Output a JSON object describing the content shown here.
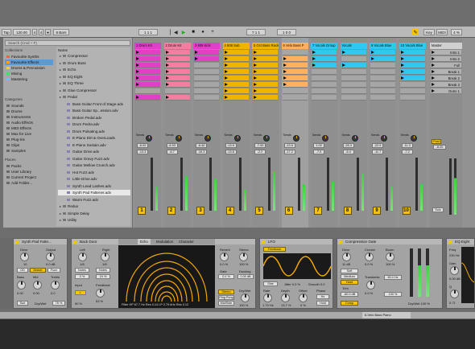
{
  "transport": {
    "tap": "Tap",
    "tempo": "120.00",
    "meter_num": "4",
    "meter_den": "4",
    "quant": "8 Bars",
    "position": "1 1 1",
    "loop_start": "7 1 1",
    "loop_len": "1 0 0",
    "key_label": "Key",
    "midi_label": "MIDI",
    "cpu": "4 %"
  },
  "browser": {
    "search_placeholder": "Search (Cmd + F)",
    "collections_header": "Collections",
    "collections": [
      "Favourite Synths",
      "Favourite Effects",
      "Drums & Percussion",
      "Mixing",
      "Mastering"
    ],
    "collection_colors": [
      "#ff5e3a",
      "#ff9f1a",
      "#ffd11a",
      "#4cd964",
      "#5ac8fa"
    ],
    "categories_header": "Categories",
    "categories": [
      "Sounds",
      "Drums",
      "Instruments",
      "Audio Effects",
      "MIDI Effects",
      "Max for Live",
      "Plug-Ins",
      "Clips",
      "Samples"
    ],
    "places_header": "Places",
    "places": [
      "Packs",
      "User Library",
      "Current Project",
      "Add Folder..."
    ],
    "name_header": "Name",
    "files": [
      "Compressor",
      "Drum Buss",
      "Echo",
      "EQ Eight",
      "EQ Three",
      "Glue Compressor",
      "Pedal",
      "Bass Guitar Front of Stage.adv",
      "Bass Guitar Sp...ession.adv",
      "Broken Pedal.adv",
      "Drum Pedra.adv",
      "Drum Pulsating.adv",
      "E-Piano Dirt & OverLoads",
      "E-Piano Sustain.adv",
      "Guitar Drive.adv",
      "Guitar Gravy Fuzz.adv",
      "Guitar Mellow Crunch.adv",
      "Hot Fuzz.adv",
      "Little Drive.adv",
      "Synth Lead Lashes.adv",
      "Synth Pad Fattener.adv",
      "Warm Fuzz.adv",
      "Redux",
      "Simple Delay",
      "Utility"
    ]
  },
  "tracks": [
    {
      "name": "1 Drum Kit",
      "color": "#e040c8",
      "num": "1"
    },
    {
      "name": "2 Drum Kit",
      "color": "#f27fa0",
      "num": "2"
    },
    {
      "name": "3 808 Kick",
      "color": "#e040c8",
      "num": "3"
    },
    {
      "name": "4 808 Sub",
      "color": "#f0b400",
      "num": "4"
    },
    {
      "name": "5 Oct Bass Rack",
      "color": "#f0b400",
      "num": "5"
    },
    {
      "name": "6 Velo Bass P",
      "color": "#ffb060",
      "num": "6"
    },
    {
      "name": "7 Vocals Group",
      "color": "#30c8f0",
      "num": "7"
    },
    {
      "name": "Vocals",
      "color": "#30c8f0",
      "num": "8"
    },
    {
      "name": "9 Vocals Blue",
      "color": "#30c8f0",
      "num": "9"
    },
    {
      "name": "10 Vocals Blue",
      "color": "#30c8f0",
      "num": "10"
    }
  ],
  "track_volumes": [
    "-6.00",
    "-8.93",
    "-6.40",
    "-13.9",
    "-7.00",
    "-13.5",
    "1.00",
    "-28.3",
    "-22.9",
    "-11.3"
  ],
  "track_peaks": [
    "-13.3",
    "-6.7",
    "-16.3",
    "-13.8",
    "-2.2",
    "-17.2",
    "-7.0",
    "-6.4",
    "-11.7",
    "-7.2"
  ],
  "sends_label": "Sends",
  "master": {
    "name": "Master",
    "scenes": [
      "Intro 1",
      "Intro 2",
      "Full",
      "Break 1",
      "Break 2",
      "Break 3",
      "Outro 1"
    ],
    "volume": "-8.20",
    "post": "Post",
    "solo": "Solo"
  },
  "devices": {
    "synth_pad": {
      "title": "Synth Pad Fatte...",
      "labels": [
        "Drive",
        "Output",
        "Bass",
        "Mid",
        "Treble",
        "Dry/Wet"
      ],
      "values": [
        "10",
        "0.0 dB",
        "0.00",
        "0.00",
        "0.0",
        "75 %"
      ],
      "buttons": [
        "OD",
        "Distort",
        "Fuzz",
        "Sub"
      ]
    },
    "back_door": {
      "title": "Back Door",
      "left": "Left",
      "right": "Right",
      "sync1": "1/8",
      "sync2": "1/8",
      "mode1": "Notes",
      "mode2": "Notes",
      "pct1": "0 %",
      "pct2": "24 %",
      "feedback": "Feedback",
      "fb_val": "63 %",
      "input": "Input",
      "dry_wet": "90 %"
    },
    "echo_tabs": [
      "Echo",
      "Modulation",
      "Character"
    ],
    "echo_footer": {
      "filter": "Filter HP",
      "hp": "67.7 Hz",
      "res1": "Res",
      "res1_val": "0.14",
      "lp": "LP",
      "lp_val": "2.79 kHz",
      "res2": "Res",
      "res2_val": "0.12"
    },
    "reverb": {
      "labels": [
        "Reverb",
        "Stereo",
        "Gate",
        "Ducking",
        "Dry/Wet"
      ],
      "values": [
        "0.0 %",
        "100 %",
        "0.0 %",
        "0.00 dB",
        "100 %"
      ],
      "buttons": [
        "Stereo",
        "Ping Pong",
        "Mid/Side"
      ]
    },
    "lfo": {
      "title": "LFO",
      "feedback": "Feedback",
      "shape": "Sine",
      "jitter": "Jitter",
      "jitter_val": "0.0 %",
      "smooth": "Smooth",
      "smooth_val": "0.0",
      "labels": [
        "Rate",
        "Depth",
        "Offset",
        "Phase"
      ],
      "values": [
        "1.79 Hz",
        "13.7 %",
        "0 %",
        "0.0"
      ],
      "hold": "Hold",
      "hz": "Hz"
    },
    "comp_gate": {
      "title": "Compression Gate",
      "labels": [
        "Drive",
        "Crunch",
        "Boom",
        "Thresh"
      ],
      "values": [
        "11 dB",
        "0.0 %",
        "100 %",
        "-60.0 dB"
      ],
      "modes": [
        "Soft",
        "Medium",
        "Hard"
      ],
      "trim": "Trim",
      "transients": "Transients",
      "trans_val": "0.0 %",
      "crunch_val": "0.0 %",
      "dry_wet": "Dry/Wet",
      "dw_val": "100 %",
      "comp": "Comp",
      "freq": "80.0 Hz",
      "decay": "100 %"
    },
    "eq8": {
      "title": "EQ Eight",
      "freq": "Freq",
      "gain": "Gain",
      "q": "Q",
      "values": [
        "230 Hz",
        "0.00 dB",
        "0.71"
      ]
    }
  },
  "status_bar": {
    "track_name": "6-Velo Bass Piano"
  }
}
